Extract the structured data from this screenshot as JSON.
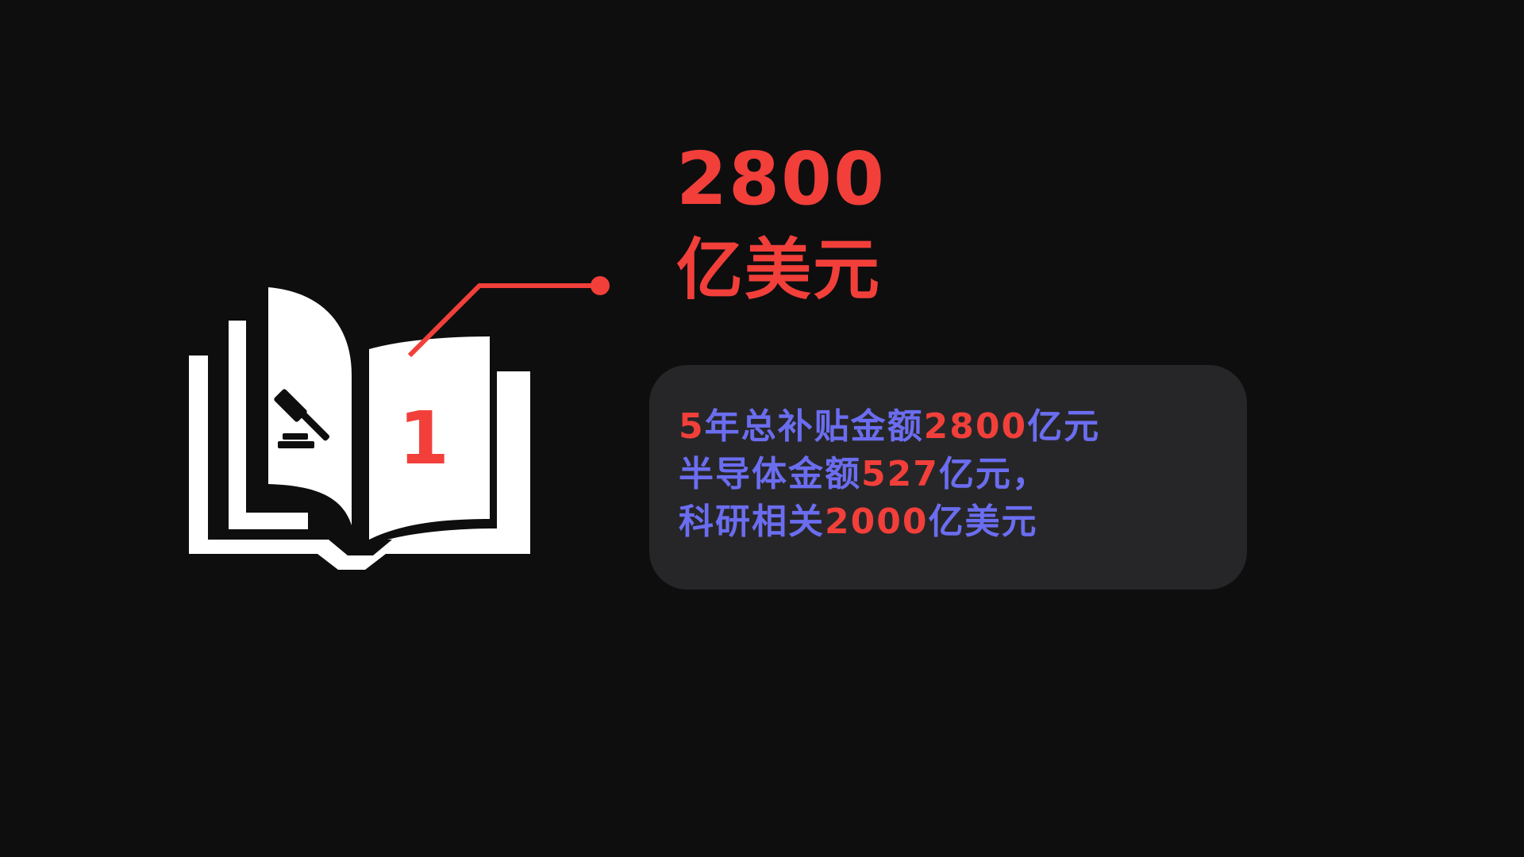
{
  "headline": {
    "amount": "2800",
    "unit": "亿美元"
  },
  "book": {
    "page_number": "1"
  },
  "info": {
    "lines": [
      [
        {
          "text": "5",
          "style": "highlight"
        },
        {
          "text": "年总补贴金额",
          "style": "normal"
        },
        {
          "text": "2800",
          "style": "highlight"
        },
        {
          "text": "亿元",
          "style": "normal"
        }
      ],
      [
        {
          "text": "半导体金额",
          "style": "normal"
        },
        {
          "text": "527",
          "style": "highlight"
        },
        {
          "text": "亿元，",
          "style": "normal"
        }
      ],
      [
        {
          "text": "科研相关",
          "style": "normal"
        },
        {
          "text": "2000",
          "style": "highlight"
        },
        {
          "text": "亿美元",
          "style": "normal"
        }
      ]
    ]
  },
  "colors": {
    "background": "#0e0e0f",
    "highlight": "#f23f3a",
    "text": "#6b6df0",
    "card": "#262628",
    "icon": "#ffffff"
  }
}
